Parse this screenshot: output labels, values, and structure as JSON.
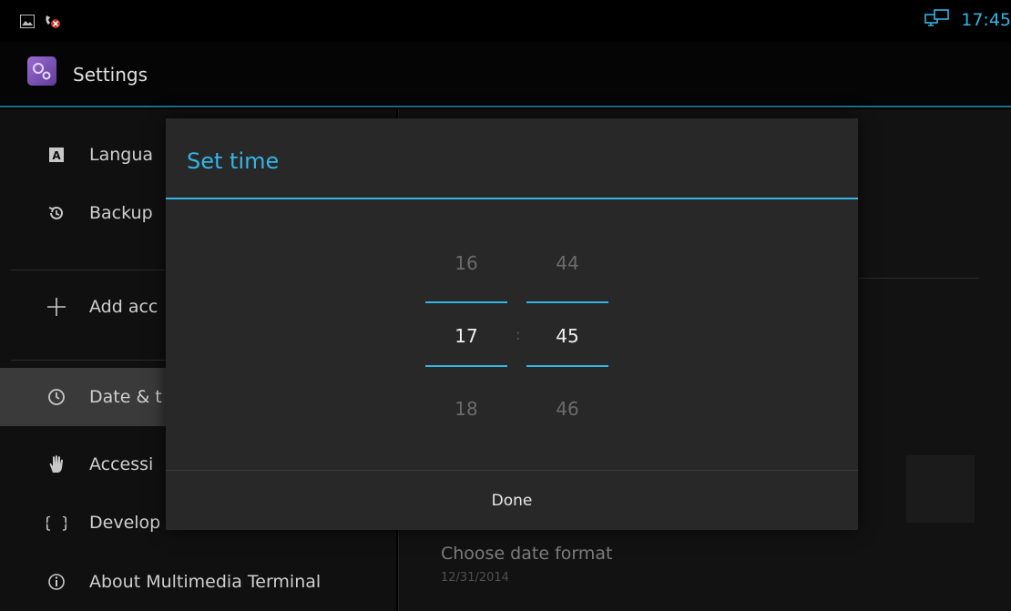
{
  "status_bar": {
    "left_icons": [
      "picture-icon",
      "call-blocked-icon"
    ],
    "right_icons": [
      "network-screens-icon"
    ],
    "time": "17:45"
  },
  "action_bar": {
    "title": "Settings"
  },
  "sidebar": {
    "items": [
      {
        "label": "Langua",
        "icon": "language-icon"
      },
      {
        "label": "Backup",
        "icon": "backup-icon"
      },
      {
        "label": "Add acc",
        "icon": "plus-icon"
      },
      {
        "label": "Date & t",
        "icon": "clock-icon"
      },
      {
        "label": "Accessi",
        "icon": "hand-icon"
      },
      {
        "label": "Develop",
        "icon": "braces-icon"
      },
      {
        "label": "About Multimedia Terminal",
        "icon": "info-icon"
      }
    ]
  },
  "content": {
    "choose_format": "Choose date format",
    "format_sample": "12/31/2014"
  },
  "dialog": {
    "title": "Set time",
    "hour": {
      "prev": "16",
      "current": "17",
      "next": "18"
    },
    "minute": {
      "prev": "44",
      "current": "45",
      "next": "46"
    },
    "separator": ":",
    "done_label": "Done"
  },
  "colors": {
    "accent": "#33b5e5"
  }
}
